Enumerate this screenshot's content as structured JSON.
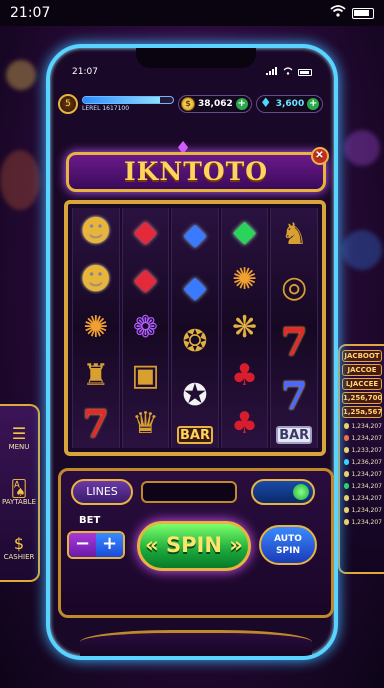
{
  "os_status": {
    "time": "21:07"
  },
  "phone_status": {
    "time": "21:07"
  },
  "hud": {
    "level_badge": "5",
    "level_text": "LEREL 1617100",
    "xp_fraction": 0.85,
    "coins": "38,062",
    "gems": "3,600"
  },
  "game": {
    "title": "IKNTOTO"
  },
  "reels": [
    [
      {
        "cls": "mask",
        "glyph": "☻",
        "name": "golden-mask-symbol"
      },
      {
        "cls": "mask",
        "glyph": "☻",
        "name": "golden-mask-symbol"
      },
      {
        "cls": "tiger",
        "glyph": "✺",
        "name": "tiger-symbol"
      },
      {
        "cls": "idol",
        "glyph": "♜",
        "name": "golden-idol-symbol"
      },
      {
        "cls": "seven",
        "glyph": "7",
        "name": "red-seven-symbol"
      }
    ],
    [
      {
        "cls": "ruby",
        "glyph": "◆",
        "name": "ruby-symbol"
      },
      {
        "cls": "ruby",
        "glyph": "◆",
        "name": "ruby-symbol"
      },
      {
        "cls": "dragon",
        "glyph": "❁",
        "name": "purple-dragon-symbol"
      },
      {
        "cls": "idol",
        "glyph": "▣",
        "name": "golden-tablet-symbol"
      },
      {
        "cls": "idol",
        "glyph": "♛",
        "name": "golden-idol-symbol"
      }
    ],
    [
      {
        "cls": "sapph",
        "glyph": "◆",
        "name": "sapphire-symbol"
      },
      {
        "cls": "sapph",
        "glyph": "◆",
        "name": "sapphire-symbol"
      },
      {
        "cls": "gdragon",
        "glyph": "❂",
        "name": "golden-dragon-symbol"
      },
      {
        "cls": "eagle",
        "glyph": "✪",
        "name": "eagle-symbol"
      },
      {
        "cls": "bar",
        "glyph": "BAR",
        "name": "bar-symbol"
      }
    ],
    [
      {
        "cls": "emer",
        "glyph": "◆",
        "name": "emerald-symbol"
      },
      {
        "cls": "tiger",
        "glyph": "✺",
        "name": "tiger-symbol"
      },
      {
        "cls": "gdragon",
        "glyph": "❋",
        "name": "golden-eagle-symbol"
      },
      {
        "cls": "cherry",
        "glyph": "♣",
        "name": "cherry-symbol"
      },
      {
        "cls": "cherry",
        "glyph": "♣",
        "name": "cherry-symbol"
      }
    ],
    [
      {
        "cls": "idol",
        "glyph": "♞",
        "name": "golden-idol-symbol"
      },
      {
        "cls": "idol",
        "glyph": "◎",
        "name": "gold-ring-symbol"
      },
      {
        "cls": "seven",
        "glyph": "7",
        "name": "red-seven-symbol"
      },
      {
        "cls": "seven blue",
        "glyph": "7",
        "name": "blue-seven-symbol"
      },
      {
        "cls": "bar silver",
        "glyph": "BAR",
        "name": "bar-symbol"
      }
    ]
  ],
  "controls": {
    "lines_label": "LINES",
    "bet_label": "BET",
    "bet_minus": "−",
    "bet_plus": "+",
    "spin_label": "« SPIN »",
    "auto_label_1": "AUTO",
    "auto_label_2": "SPIN"
  },
  "left_panel": {
    "menu": "MENU",
    "paytable": "PAYTABLE",
    "cashier": "CASHIER"
  },
  "right_panel": {
    "jackpot_1": "JACBOOT",
    "jackpot_2": "JACCOE",
    "jackpot_3": "LJACCEE",
    "jackpot_4": "1,256,700",
    "jackpot_5": "1,25a,567",
    "rows": [
      {
        "value": "1,234,207",
        "color": "#ffd45a"
      },
      {
        "value": "1,234,207",
        "color": "#ff6a3a"
      },
      {
        "value": "1,233,207",
        "color": "#ffd45a"
      },
      {
        "value": "1,236,207",
        "color": "#3ad4ff"
      },
      {
        "value": "1,234,207",
        "color": "#ffd45a"
      },
      {
        "value": "1,234,207",
        "color": "#2ad45a"
      },
      {
        "value": "1,234,207",
        "color": "#ffd45a"
      },
      {
        "value": "1,234,207",
        "color": "#ffd45a"
      },
      {
        "value": "1,234,207",
        "color": "#ffd45a"
      }
    ]
  }
}
